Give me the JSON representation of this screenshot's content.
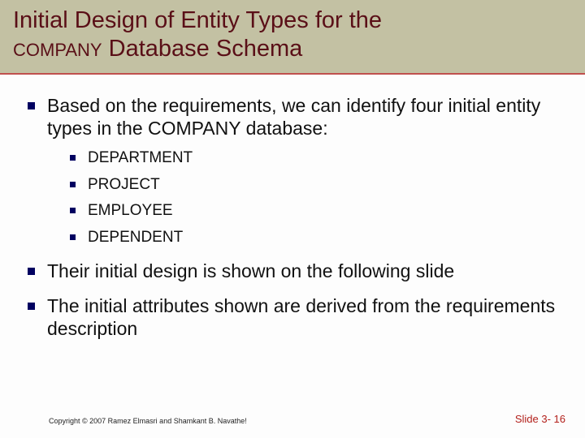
{
  "title": {
    "line1_part1": "Initial Design of Entity Types for the",
    "line2_small": "COMPANY",
    "line2_rest": " Database Schema"
  },
  "bullets": {
    "b1": "Based on the requirements, we can identify four initial entity types in the COMPANY database:",
    "sub": {
      "s1": "DEPARTMENT",
      "s2": "PROJECT",
      "s3": "EMPLOYEE",
      "s4": "DEPENDENT"
    },
    "b2": "Their initial design is shown on the following slide",
    "b3": "The initial attributes shown are derived from the requirements description"
  },
  "footer": {
    "copyright": "Copyright © 2007 Ramez Elmasri and Shamkant B. Navathe!",
    "slide": "Slide 3- 16"
  }
}
